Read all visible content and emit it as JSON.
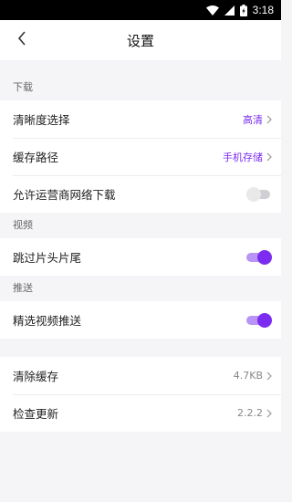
{
  "status_bar": {
    "time": "3:18",
    "icons": [
      "wifi-icon",
      "signal-icon",
      "battery-icon"
    ]
  },
  "header": {
    "back_icon": "chevron-left-icon",
    "title": "设置"
  },
  "sections": {
    "download": {
      "title": "下载",
      "rows": {
        "quality": {
          "label": "清晰度选择",
          "value": "高清"
        },
        "cache_path": {
          "label": "缓存路径",
          "value": "手机存储"
        },
        "mobile_download": {
          "label": "允许运营商网络下载",
          "enabled": false
        }
      }
    },
    "video": {
      "title": "视频",
      "rows": {
        "skip_intro": {
          "label": "跳过片头片尾",
          "enabled": true
        }
      }
    },
    "push": {
      "title": "推送",
      "rows": {
        "featured_push": {
          "label": "精选视频推送",
          "enabled": true
        }
      }
    },
    "misc": {
      "rows": {
        "clear_cache": {
          "label": "清除缓存",
          "value": "4.7KB"
        },
        "check_update": {
          "label": "检查更新",
          "value": "2.2.2"
        }
      }
    }
  },
  "colors": {
    "accent": "#7b2cf0",
    "accent_track": "#b794f6",
    "background": "#f5f5f7"
  }
}
